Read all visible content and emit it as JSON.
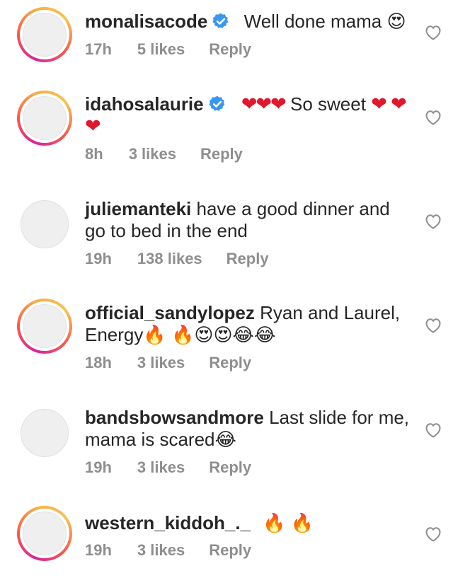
{
  "comments": [
    {
      "username": "monalisacode",
      "verified": true,
      "text": "Well done mama 😍",
      "time": "17h",
      "likes": "5 likes",
      "reply": "Reply",
      "avatar_style": "story"
    },
    {
      "username": "idahosalaurie",
      "verified": true,
      "text": "❤❤❤ So sweet ❤ ❤❤",
      "time": "8h",
      "likes": "3 likes",
      "reply": "Reply",
      "avatar_style": "story"
    },
    {
      "username": "juliemanteki",
      "verified": false,
      "text": "have a good dinner and go to bed in the end",
      "time": "19h",
      "likes": "138 likes",
      "reply": "Reply",
      "avatar_style": "plain"
    },
    {
      "username": "official_sandylopez",
      "verified": false,
      "text": "Ryan and Laurel, Energy🔥 🔥😍😍😂😂",
      "time": "18h",
      "likes": "3 likes",
      "reply": "Reply",
      "avatar_style": "story"
    },
    {
      "username": "bandsbowsandmore",
      "verified": false,
      "text": "Last slide for me, mama is scared😂",
      "time": "19h",
      "likes": "3 likes",
      "reply": "Reply",
      "avatar_style": "plain"
    },
    {
      "username": "western_kiddoh_._",
      "verified": false,
      "text": "🔥 🔥",
      "time": "19h",
      "likes": "3 likes",
      "reply": "Reply",
      "avatar_style": "story"
    }
  ],
  "colors": {
    "text": "#262626",
    "meta": "#8e8e8e",
    "verified": "#3897f0",
    "heart_outline": "#8e8e8e"
  },
  "icons": {
    "like": "heart-outline-icon",
    "verified": "verified-badge-icon"
  }
}
